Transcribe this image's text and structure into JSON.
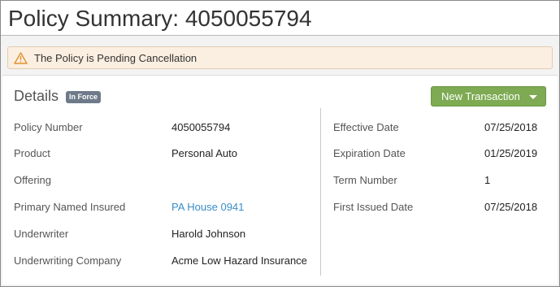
{
  "page": {
    "title": "Policy Summary: 4050055794"
  },
  "alert": {
    "icon": "warning-triangle-icon",
    "text": "The Policy is Pending Cancellation"
  },
  "details": {
    "title": "Details",
    "status_badge": "In Force",
    "new_transaction_label": "New Transaction",
    "left_fields": [
      {
        "label": "Policy Number",
        "value": "4050055794"
      },
      {
        "label": "Product",
        "value": "Personal Auto"
      },
      {
        "label": "Offering",
        "value": ""
      },
      {
        "label": "Primary Named Insured",
        "value": "PA House 0941"
      },
      {
        "label": "Underwriter",
        "value": "Harold Johnson"
      },
      {
        "label": "Underwriting Company",
        "value": "Acme Low Hazard Insurance"
      }
    ],
    "right_fields": [
      {
        "label": "Effective Date",
        "value": "07/25/2018"
      },
      {
        "label": "Expiration Date",
        "value": "01/25/2019"
      },
      {
        "label": "Term Number",
        "value": "1"
      },
      {
        "label": "First Issued Date",
        "value": "07/25/2018"
      }
    ]
  },
  "colors": {
    "button": "#7daa52",
    "link": "#3a8cc8",
    "alert_bg": "#fbefe1",
    "badge": "#6e7a8a"
  }
}
